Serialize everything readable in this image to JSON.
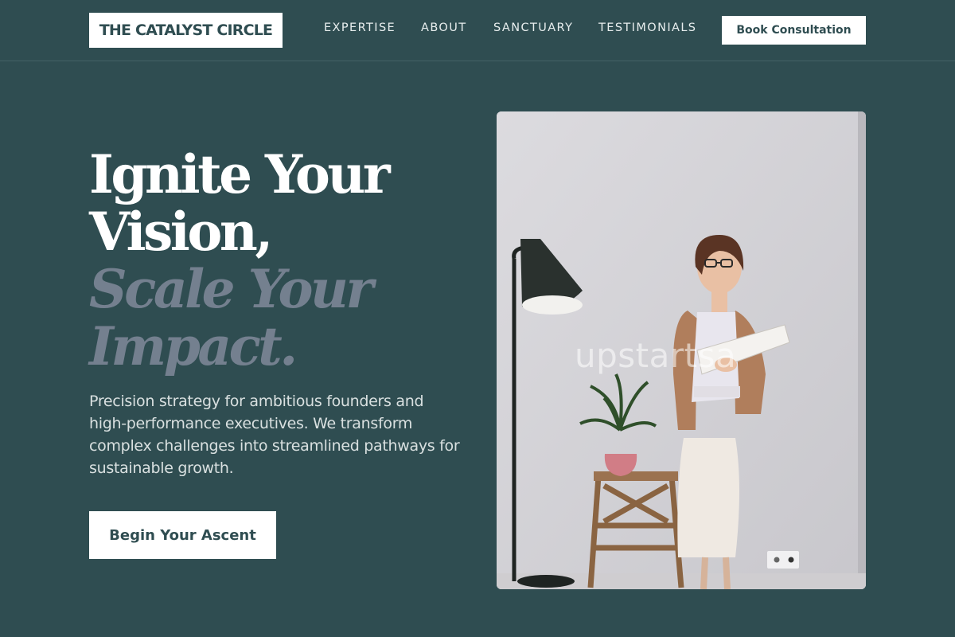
{
  "brand": {
    "name": "THE CATALYST CIRCLE"
  },
  "nav": {
    "items": [
      "EXPERTISE",
      "ABOUT",
      "SANCTUARY",
      "TESTIMONIALS"
    ],
    "cta_label": "Book Consultation"
  },
  "hero": {
    "headline_line1": "Ignite Your",
    "headline_line2": "Vision,",
    "headline_accent_line1": "Scale Your",
    "headline_accent_line2": "Impact.",
    "subtext": "Precision strategy for ambitious founders and high-performance executives. We transform complex challenges into streamlined pathways for sustainable growth.",
    "cta_label": "Begin Your Ascent",
    "image": {
      "subject": "woman with glasses holding an open book beside a floor lamp, plant and wooden step stool",
      "watermark": "upstartsa"
    }
  },
  "colors": {
    "background": "#2f4d51",
    "accent_text": "#74808f",
    "button_bg": "#ffffff",
    "button_text": "#2f4d51"
  }
}
